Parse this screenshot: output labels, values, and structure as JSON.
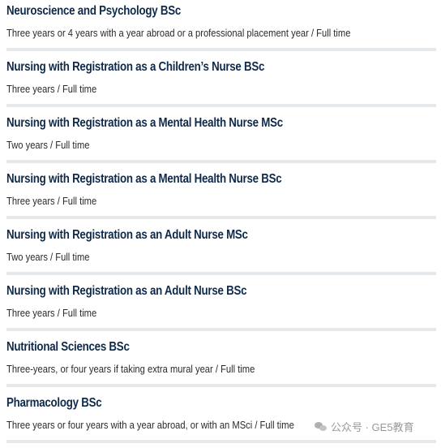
{
  "courses": [
    {
      "title": "Neuroscience and Psychology BSc",
      "details": "Three years or 4 years with a year abroad or a professional placement year / Full time"
    },
    {
      "title": "Nursing with Registration as a Children’s Nurse BSc",
      "details": "Three years / Full time"
    },
    {
      "title": "Nursing with Registration as a Mental Health Nurse MSc",
      "details": "Two years / Full time"
    },
    {
      "title": "Nursing with Registration as a Mental Health Nurse BSc",
      "details": "Three years / Full time"
    },
    {
      "title": "Nursing with Registration as an Adult Nurse MSc",
      "details": "Two years / Full time"
    },
    {
      "title": "Nursing with Registration as an Adult Nurse BSc",
      "details": "Three years / Full time"
    },
    {
      "title": "Nutritional Sciences BSc",
      "details": "Three-years, or four years if taking extra mural year / Full time"
    },
    {
      "title": "Pharmacology BSc",
      "details": "Three years or four years with a year abroad, or with an MSci / Full time"
    }
  ],
  "watermark": {
    "text": "公众号 · GE5教育",
    "icon": "wechat-icon"
  },
  "colors": {
    "title": "#0f2a4a",
    "divider": "#e5e9ec"
  }
}
